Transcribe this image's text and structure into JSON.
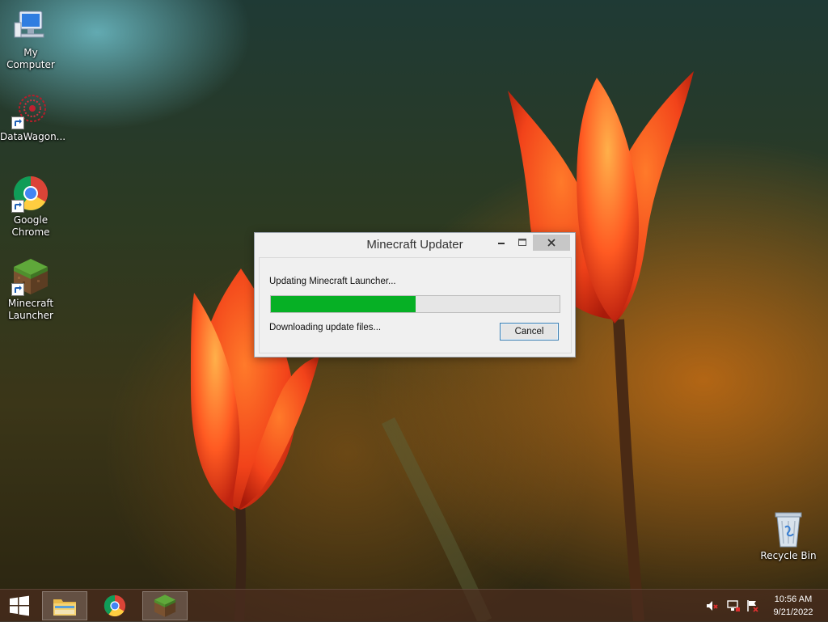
{
  "desktop": {
    "icons": [
      {
        "label": "My Computer"
      },
      {
        "label": "DataWagon..."
      },
      {
        "label": "Google Chrome"
      },
      {
        "label": "Minecraft Launcher"
      },
      {
        "label": "Recycle Bin"
      }
    ]
  },
  "dialog": {
    "title": "Minecraft Updater",
    "status_text": "Updating Minecraft Launcher...",
    "progress_fraction": 0.5,
    "detail_text": "Downloading update files...",
    "cancel_label": "Cancel"
  },
  "taskbar": {
    "pinned": [
      {
        "name": "start",
        "icon": "windows-logo-icon"
      },
      {
        "name": "file-explorer",
        "icon": "folder-icon"
      },
      {
        "name": "chrome",
        "icon": "chrome-icon"
      },
      {
        "name": "minecraft",
        "icon": "minecraft-grass-block-icon"
      }
    ],
    "tray_icons": [
      "volume-muted-icon",
      "network-icon",
      "action-center-flag-icon"
    ],
    "clock": {
      "time": "10:56 AM",
      "date": "9/21/2022"
    }
  },
  "colors": {
    "progress_fill": "#06b025",
    "taskbar": "#4b2d1e",
    "dialog_bg": "#f0f0f0"
  }
}
